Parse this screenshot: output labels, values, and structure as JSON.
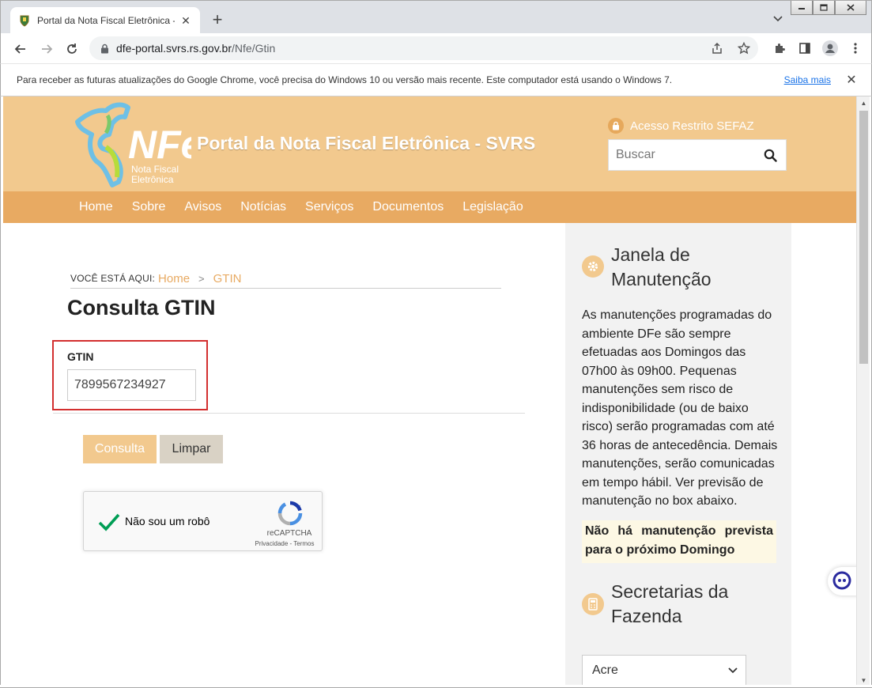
{
  "browser": {
    "tab_title": "Portal da Nota Fiscal Eletrônica - SV",
    "url_domain": "dfe-portal.svrs.rs.gov.br",
    "url_path": "/Nfe/Gtin",
    "infobar_text": "Para receber as futuras atualizações do Google Chrome, você precisa do Windows 10 ou versão mais recente. Este computador está usando o Windows 7.",
    "infobar_link": "Saiba mais"
  },
  "header": {
    "logo_text": "NFe",
    "logo_sub1": "Nota Fiscal",
    "logo_sub2": "Eletrônica",
    "title": "Portal da Nota Fiscal Eletrônica - SVRS",
    "restricted_label": "Acesso Restrito SEFAZ",
    "search_placeholder": "Buscar"
  },
  "nav": {
    "items": [
      "Home",
      "Sobre",
      "Avisos",
      "Notícias",
      "Serviços",
      "Documentos",
      "Legislação"
    ]
  },
  "breadcrumb": {
    "label": "VOCÊ ESTÁ AQUI:",
    "home": "Home",
    "separator": ">",
    "current": "GTIN"
  },
  "main": {
    "title": "Consulta GTIN",
    "gtin_label": "GTIN",
    "gtin_value": "7899567234927",
    "btn_consulta": "Consulta",
    "btn_limpar": "Limpar",
    "recaptcha_label": "Não sou um robô",
    "recaptcha_brand": "reCAPTCHA",
    "recaptcha_terms": "Privacidade - Termos"
  },
  "sidebar": {
    "maint_title_1": "Janela de",
    "maint_title_2": "Manutenção",
    "maint_text": "As manutenções programadas do ambiente DFe são sempre efetuadas aos Domingos das 07h00 às 09h00. Pequenas manutenções sem risco de indisponibilidade (ou de baixo risco) serão programadas com até 36 horas de antecedência. Demais manutenções, serão comunicadas em tempo hábil. Ver previsão de manutenção no box abaixo.",
    "maint_notice": "Não há manutenção prevista para o próximo Domingo",
    "secretarias_title_1": "Secretarias da",
    "secretarias_title_2": "Fazenda",
    "state_selected": "Acre"
  },
  "colors": {
    "header_bg": "#f2c98e",
    "nav_bg": "#e8aa62",
    "accent": "#e8aa62",
    "highlight_border": "#d32f2f"
  }
}
